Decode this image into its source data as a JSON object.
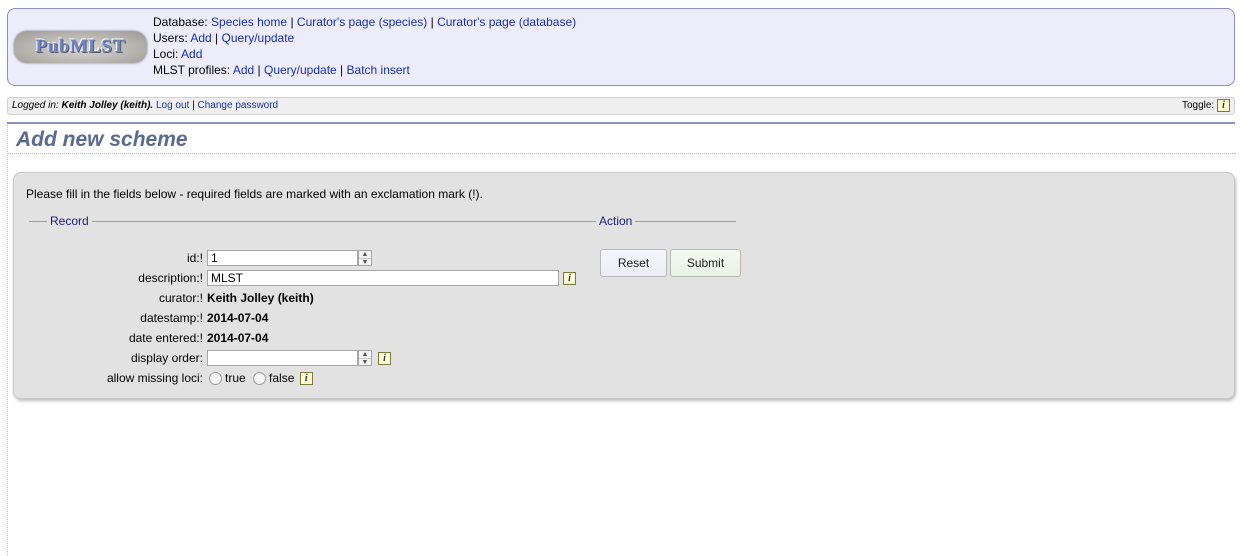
{
  "header": {
    "logo_text": "PubMLST",
    "database_label": "Database:",
    "database_links": [
      "Species home",
      "Curator's page (species)",
      "Curator's page (database)"
    ],
    "users_label": "Users:",
    "users_links": [
      "Add",
      "Query/update"
    ],
    "loci_label": "Loci:",
    "loci_links": [
      "Add"
    ],
    "profiles_label": "MLST profiles:",
    "profiles_links": [
      "Add",
      "Query/update",
      "Batch insert"
    ]
  },
  "login_bar": {
    "logged_in_prefix": "Logged in: ",
    "user": "Keith Jolley (keith).",
    "logout": "Log out",
    "change_password": "Change password",
    "toggle_label": "Toggle:",
    "toggle_icon": "i"
  },
  "page": {
    "title": "Add new scheme",
    "instructions": "Please fill in the fields below - required fields are marked with an exclamation mark (!)."
  },
  "record": {
    "legend": "Record",
    "fields": {
      "id": {
        "label": "id:!",
        "value": "1"
      },
      "description": {
        "label": "description:!",
        "value": "MLST"
      },
      "curator": {
        "label": "curator:!",
        "value": "Keith Jolley (keith)"
      },
      "datestamp": {
        "label": "datestamp:!",
        "value": "2014-07-04"
      },
      "date_entered": {
        "label": "date entered:!",
        "value": "2014-07-04"
      },
      "display_order": {
        "label": "display order:",
        "value": ""
      },
      "allow_missing_loci": {
        "label": "allow missing loci:",
        "options": [
          "true",
          "false"
        ],
        "selected": null
      }
    },
    "info_icon": "i"
  },
  "action": {
    "legend": "Action",
    "reset": "Reset",
    "submit": "Submit"
  },
  "colors": {
    "menu_bg": "#ececfb",
    "link": "#1a2fb8",
    "title": "#5a6a95",
    "legend": "#1a2278",
    "box_bg": "#e2e2e2"
  }
}
